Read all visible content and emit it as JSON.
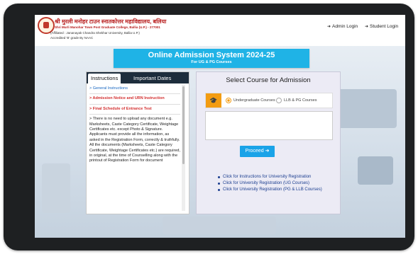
{
  "header": {
    "college_name_hindi": "श्री मुरली मनोहर टाउन स्नातकोत्तर महाविद्यालय, बलिया",
    "college_name_english": "Shri Murli Manohar Town Post Graduate College, Ballia (U.P.) - 277001",
    "affiliation": "(Affiliated : Jananayak Chandra Shekhar University, Ballia U.P.)",
    "accreditation": "Accredited 'B' grade By NAAC",
    "admin_login": "Admin Login",
    "student_login": "Student Login"
  },
  "title": {
    "main": "Online Admission System 2024-25",
    "sub": "For UG & PG Courses"
  },
  "left_panel": {
    "tabs": [
      "Instructions",
      "Important Dates"
    ],
    "items": [
      "> General Instructions",
      "> Admission Notice and URN Instruction",
      "> Final Schedule of Entrance Test",
      "> There is no need to upload any document e.g. Marksheets, Caste Category Certificate, Weightage Certificates etc. except Photo & Signature. Applicants must provide all the information, as asked in the Registration Form, correctly & truthfully. All the documents (Marksheets, Caste Category Certificate, Weightage Certificates etc.) are required, in original, at the time of Counselling along with the printout of Registration Form for document"
    ]
  },
  "right_panel": {
    "title": "Select Course for Admission",
    "options": [
      "Undergraduate Courses",
      "LLB & PG Courses"
    ],
    "proceed": "Proceed",
    "links": [
      "Click for Instructions for University Registration",
      "Click for University Registration (UG Courses)",
      "Click for University Registration (PG & LLB Courses)"
    ]
  },
  "colors": {
    "accent": "#1fb3e6",
    "tab_dark": "#1d2d3c",
    "orange": "#f39c12",
    "red_link": "#d32f2f"
  }
}
